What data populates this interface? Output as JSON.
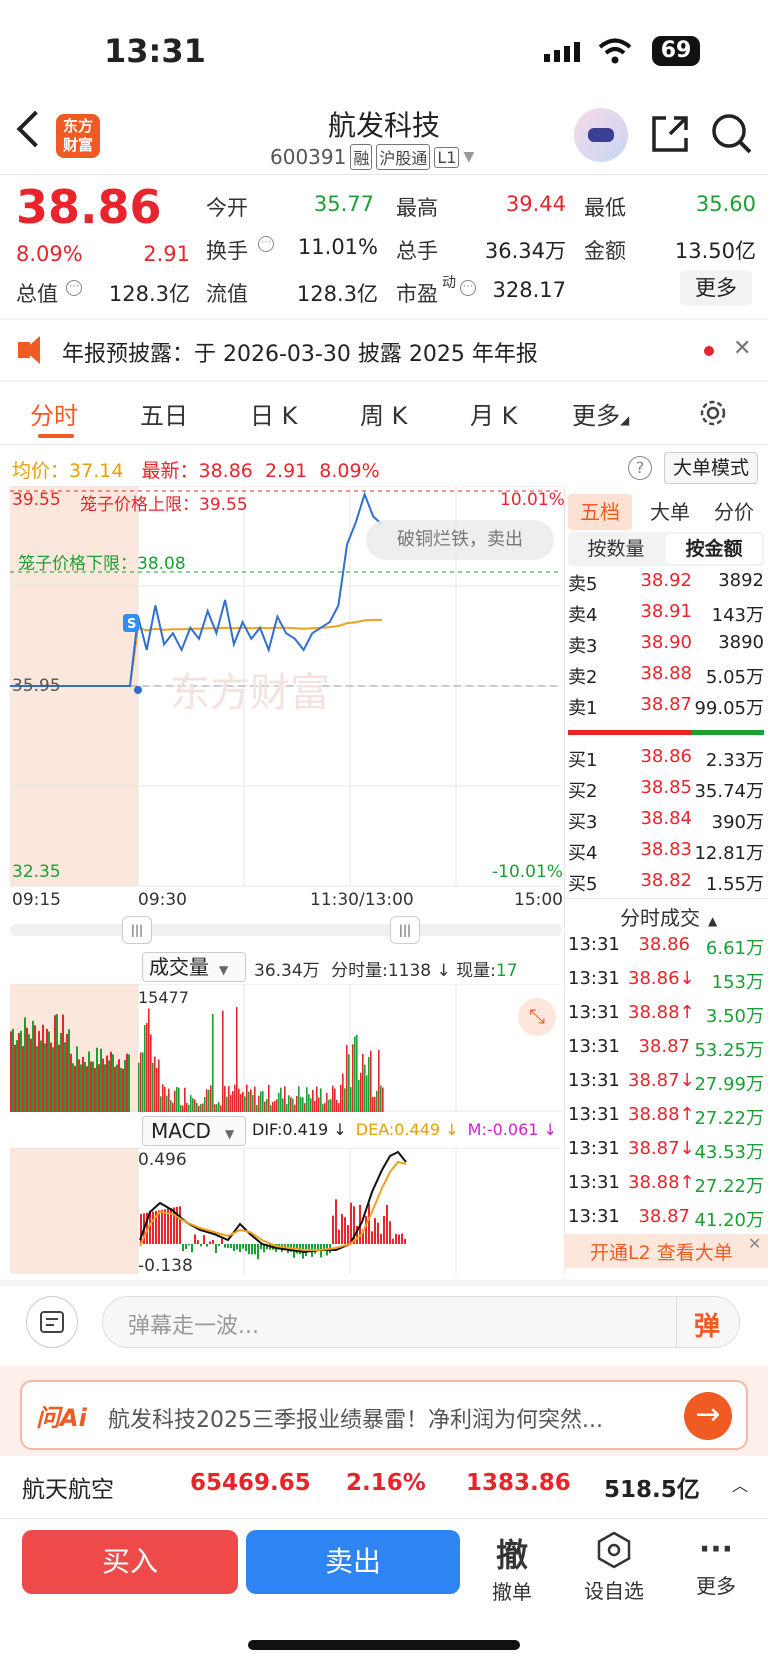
{
  "status": {
    "time": "13:31",
    "battery": "69"
  },
  "header": {
    "logo": "东方\n财富",
    "name": "航发科技",
    "code": "600391",
    "tags": [
      "融",
      "沪股通",
      "L1"
    ]
  },
  "quote": {
    "price": "38.86",
    "pct": "8.09%",
    "chg": "2.91",
    "open_label": "今开",
    "open": "35.77",
    "high_label": "最高",
    "high": "39.44",
    "low_label": "最低",
    "low": "35.60",
    "turnover_label": "换手",
    "turnover": "11.01%",
    "volume_label": "总手",
    "volume": "36.34万",
    "amount_label": "金额",
    "amount": "13.50亿",
    "mcap_label": "总值",
    "mcap": "128.3亿",
    "float_label": "流值",
    "float": "128.3亿",
    "pe_label": "市盈",
    "pe_sup": "动",
    "pe": "328.17",
    "more": "更多"
  },
  "notice": {
    "text": "年报预披露：于 2026-03-30 披露 2025 年年报"
  },
  "tabs": [
    "分时",
    "五日",
    "日 K",
    "周 K",
    "月 K",
    "更多"
  ],
  "chart_info": {
    "avg_label": "均价：",
    "avg": "37.14",
    "last_label": "最新：",
    "last": "38.86",
    "chg": "2.91",
    "pct": "8.09%",
    "mode": "大单模式"
  },
  "chart_data": {
    "type": "line",
    "y_top": "39.55",
    "y_mid": "35.95",
    "y_bottom": "32.35",
    "pct_top": "10.01%",
    "pct_bottom": "-10.01%",
    "upper_limit_label": "笼子价格上限：39.55",
    "lower_limit_label": "笼子价格下限：38.08",
    "x_labels": [
      "09:15",
      "09:30",
      "11:30/13:00",
      "15:00"
    ],
    "bubble": "破铜烂铁，卖出",
    "watermark": "东方财富",
    "series": [
      {
        "values": [
          35.95,
          35.95,
          35.95,
          35.95,
          35.95,
          35.95,
          35.95,
          37.2,
          36.6,
          37.4,
          36.7,
          36.9,
          36.6,
          37.0,
          36.8,
          37.3,
          36.9,
          37.5,
          36.7,
          37.1,
          36.8,
          37.0,
          36.6,
          37.2,
          36.9,
          36.8,
          36.6,
          36.9,
          37.0,
          37.1,
          37.4,
          38.5,
          38.9,
          39.4,
          39.0,
          38.86
        ]
      },
      {
        "values": [
          35.95,
          35.95,
          35.95,
          35.95,
          35.95,
          35.95,
          35.95,
          37.0,
          36.95,
          36.98,
          36.96,
          36.97,
          36.97,
          36.98,
          36.98,
          36.99,
          36.99,
          37.0,
          36.99,
          37.0,
          36.99,
          37.0,
          36.99,
          37.0,
          37.0,
          36.99,
          36.98,
          36.99,
          37.0,
          37.01,
          37.03,
          37.08,
          37.1,
          37.13,
          37.14,
          37.14
        ]
      }
    ]
  },
  "volume_panel": {
    "label": "成交量",
    "total": "36.34万",
    "tick_label": "分时量:",
    "tick": "1138",
    "cur_label": "现量:",
    "cur": "17",
    "max": "15477"
  },
  "macd_panel": {
    "label": "MACD",
    "dif": "DIF:0.419",
    "dea": "DEA:0.449",
    "m": "M:-0.061",
    "top": "0.496",
    "bottom": "-0.138"
  },
  "orderbook": {
    "tabs": [
      "五档",
      "大单",
      "分价"
    ],
    "subtabs": [
      "按数量",
      "按金额"
    ],
    "asks": [
      {
        "label": "卖5",
        "price": "38.92",
        "vol": "3892"
      },
      {
        "label": "卖4",
        "price": "38.91",
        "vol": "143万"
      },
      {
        "label": "卖3",
        "price": "38.90",
        "vol": "3890"
      },
      {
        "label": "卖2",
        "price": "38.88",
        "vol": "5.05万"
      },
      {
        "label": "卖1",
        "price": "38.87",
        "vol": "99.05万"
      }
    ],
    "bids": [
      {
        "label": "买1",
        "price": "38.86",
        "vol": "2.33万"
      },
      {
        "label": "买2",
        "price": "38.85",
        "vol": "35.74万"
      },
      {
        "label": "买3",
        "price": "38.84",
        "vol": "390万"
      },
      {
        "label": "买4",
        "price": "38.83",
        "vol": "12.81万"
      },
      {
        "label": "买5",
        "price": "38.82",
        "vol": "1.55万"
      }
    ],
    "ticks_title": "分时成交",
    "ticks": [
      {
        "t": "13:31",
        "p": "38.86",
        "v": "6.61万"
      },
      {
        "t": "13:31",
        "p": "38.86↓",
        "v": "153万"
      },
      {
        "t": "13:31",
        "p": "38.88↑",
        "v": "3.50万"
      },
      {
        "t": "13:31",
        "p": "38.87",
        "v": "53.25万"
      },
      {
        "t": "13:31",
        "p": "38.87↓",
        "v": "27.99万"
      },
      {
        "t": "13:31",
        "p": "38.88↑",
        "v": "27.22万"
      },
      {
        "t": "13:31",
        "p": "38.87↓",
        "v": "43.53万"
      },
      {
        "t": "13:31",
        "p": "38.88↑",
        "v": "27.22万"
      },
      {
        "t": "13:31",
        "p": "38.87",
        "v": "41.20万"
      }
    ],
    "l2": "开通L2 查看大单"
  },
  "danmu": {
    "placeholder": "弹幕走一波...",
    "btn": "弹"
  },
  "ai": {
    "logo": "问Ai",
    "text": "航发科技2025三季报业绩暴雷！净利润为何突然..."
  },
  "index": {
    "name": "航天航空",
    "value": "65469.65",
    "pct": "2.16%",
    "chg": "1383.86",
    "amount": "518.5亿"
  },
  "actions": {
    "buy": "买入",
    "sell": "卖出",
    "cancel_glyph": "撤",
    "cancel": "撤单",
    "watch": "设自选",
    "more": "更多"
  }
}
